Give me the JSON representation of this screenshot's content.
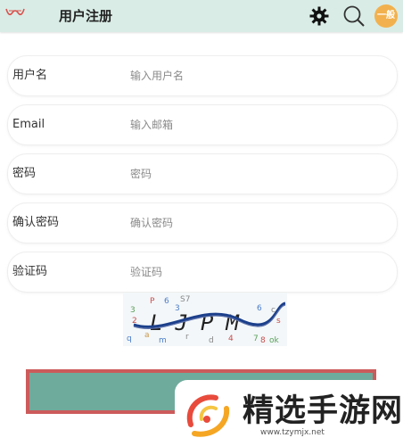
{
  "header": {
    "title": "用户注册",
    "avatar_label": "一般",
    "icons": [
      "logo-icon",
      "gear-icon",
      "search-icon"
    ]
  },
  "form": {
    "rows": [
      {
        "label": "用户名",
        "placeholder": "输入用户名"
      },
      {
        "label": "Email",
        "placeholder": "输入邮箱"
      },
      {
        "label": "密码",
        "placeholder": "密码"
      },
      {
        "label": "确认密码",
        "placeholder": "确认密码"
      },
      {
        "label": "验证码",
        "placeholder": "验证码"
      }
    ]
  },
  "captcha": {
    "text": "LJPM",
    "noise": [
      "P",
      "6",
      "S7",
      "3",
      "2",
      "3",
      "6",
      "c",
      "s",
      "a",
      "q",
      "m",
      "d",
      "4",
      "r",
      "7",
      "8",
      "ok"
    ]
  },
  "watermark": {
    "text": "精选手游网",
    "url": "www.tzymjx.net"
  },
  "colors": {
    "header_bg": "#d9ece6",
    "avatar_bg": "#f2b14e",
    "submit_fill": "#6fab9c",
    "submit_border": "#cc5b5b"
  }
}
